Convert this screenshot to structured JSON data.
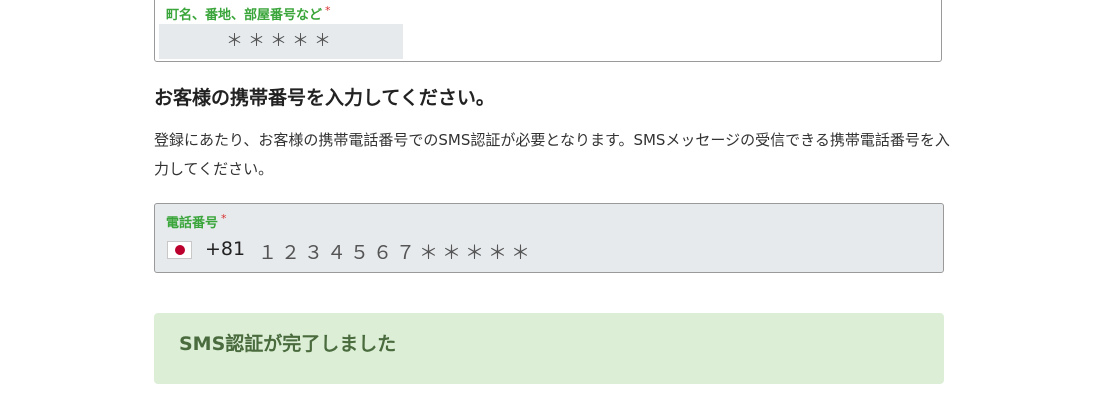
{
  "address_field": {
    "label": "町名、番地、部屋番号など",
    "required_mark": "*",
    "value": "＊＊＊＊＊"
  },
  "phone_section": {
    "heading": "お客様の携帯番号を入力してください。",
    "description": "登録にあたり、お客様の携帯電話番号でのSMS認証が必要となります。SMSメッセージの受信できる携帯電話番号を入力してください。"
  },
  "phone_field": {
    "label": "電話番号",
    "required_mark": "*",
    "country_flag": "japan-flag-icon",
    "country_code": "+81",
    "value": "１２３４５６７＊＊＊＊＊"
  },
  "status": {
    "message": "SMS認証が完了しました"
  },
  "colors": {
    "label_green": "#3aa53a",
    "required_red": "#d93030",
    "field_background": "#e6eaed",
    "success_background": "#dcefd6",
    "success_text": "#4a6b3e"
  }
}
